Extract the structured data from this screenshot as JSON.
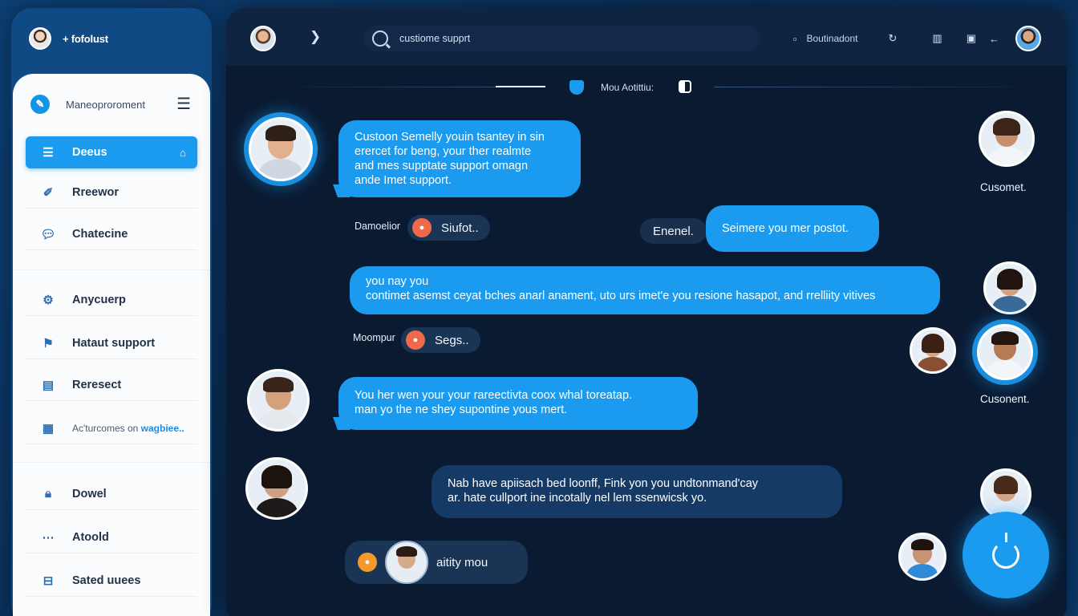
{
  "brand": {
    "label": "+ fofolust"
  },
  "sidebar": {
    "header_title": "Maneoproroment",
    "items": [
      {
        "label": "Deeus",
        "icon": "list-icon",
        "active": true
      },
      {
        "label": "Rreewor",
        "icon": "pen-icon"
      },
      {
        "label": "Chatecine",
        "icon": "chat-icon"
      },
      {
        "label": "Anycuerp",
        "icon": "gear-icon"
      },
      {
        "label": "Hataut support",
        "icon": "flag-icon"
      },
      {
        "label": "Reresect",
        "icon": "document-icon"
      },
      {
        "label": "Ac'turcomes on",
        "label_emph": "wagbiee..",
        "icon": "chart-icon"
      },
      {
        "label": "Dowel",
        "icon": "lock-icon"
      },
      {
        "label": "Atoold",
        "icon": "dots-icon"
      },
      {
        "label": "Sated uuees",
        "icon": "minus-box-icon"
      }
    ]
  },
  "topbar": {
    "search_text": "custiome supprt",
    "right_label": "Boutinadont"
  },
  "divider": {
    "label": "Mou Aotittiu:"
  },
  "chat": {
    "msg1": [
      "Custoon Semelly youin tsantey in sin",
      "erercet for beng,  your ther realmte",
      "and mes supptate support omagn",
      "ande Imet support."
    ],
    "label1": "Damoelior",
    "pill1": "Siufot..",
    "label2": "Enenel.",
    "msg2": "Seimere you mer postot.",
    "cust1": "Cusomet.",
    "msg3": [
      "you nay you",
      "contimet asemst ceyat bches anarl anament, uto urs imet'e you resione hasapot, and rrelliity vitives"
    ],
    "label3": "Moompur",
    "pill2": "Segs..",
    "cust2": "Cusonent.",
    "msg4": [
      "You her wen your your rareectivta coox whal toreatap.",
      "man yo the ne shey supontine yous mert."
    ],
    "msg5": [
      "Nab have apiisach bed loonff, Fink yon you undtonmand'cay",
      "ar. hate cullport ine incotally nel lem ssenwicsk yo."
    ],
    "pill3": "aitity mou"
  },
  "colors": {
    "accent": "#1a9bf0",
    "panel": "#0a1a31",
    "sidebar": "#fbfcfe"
  }
}
